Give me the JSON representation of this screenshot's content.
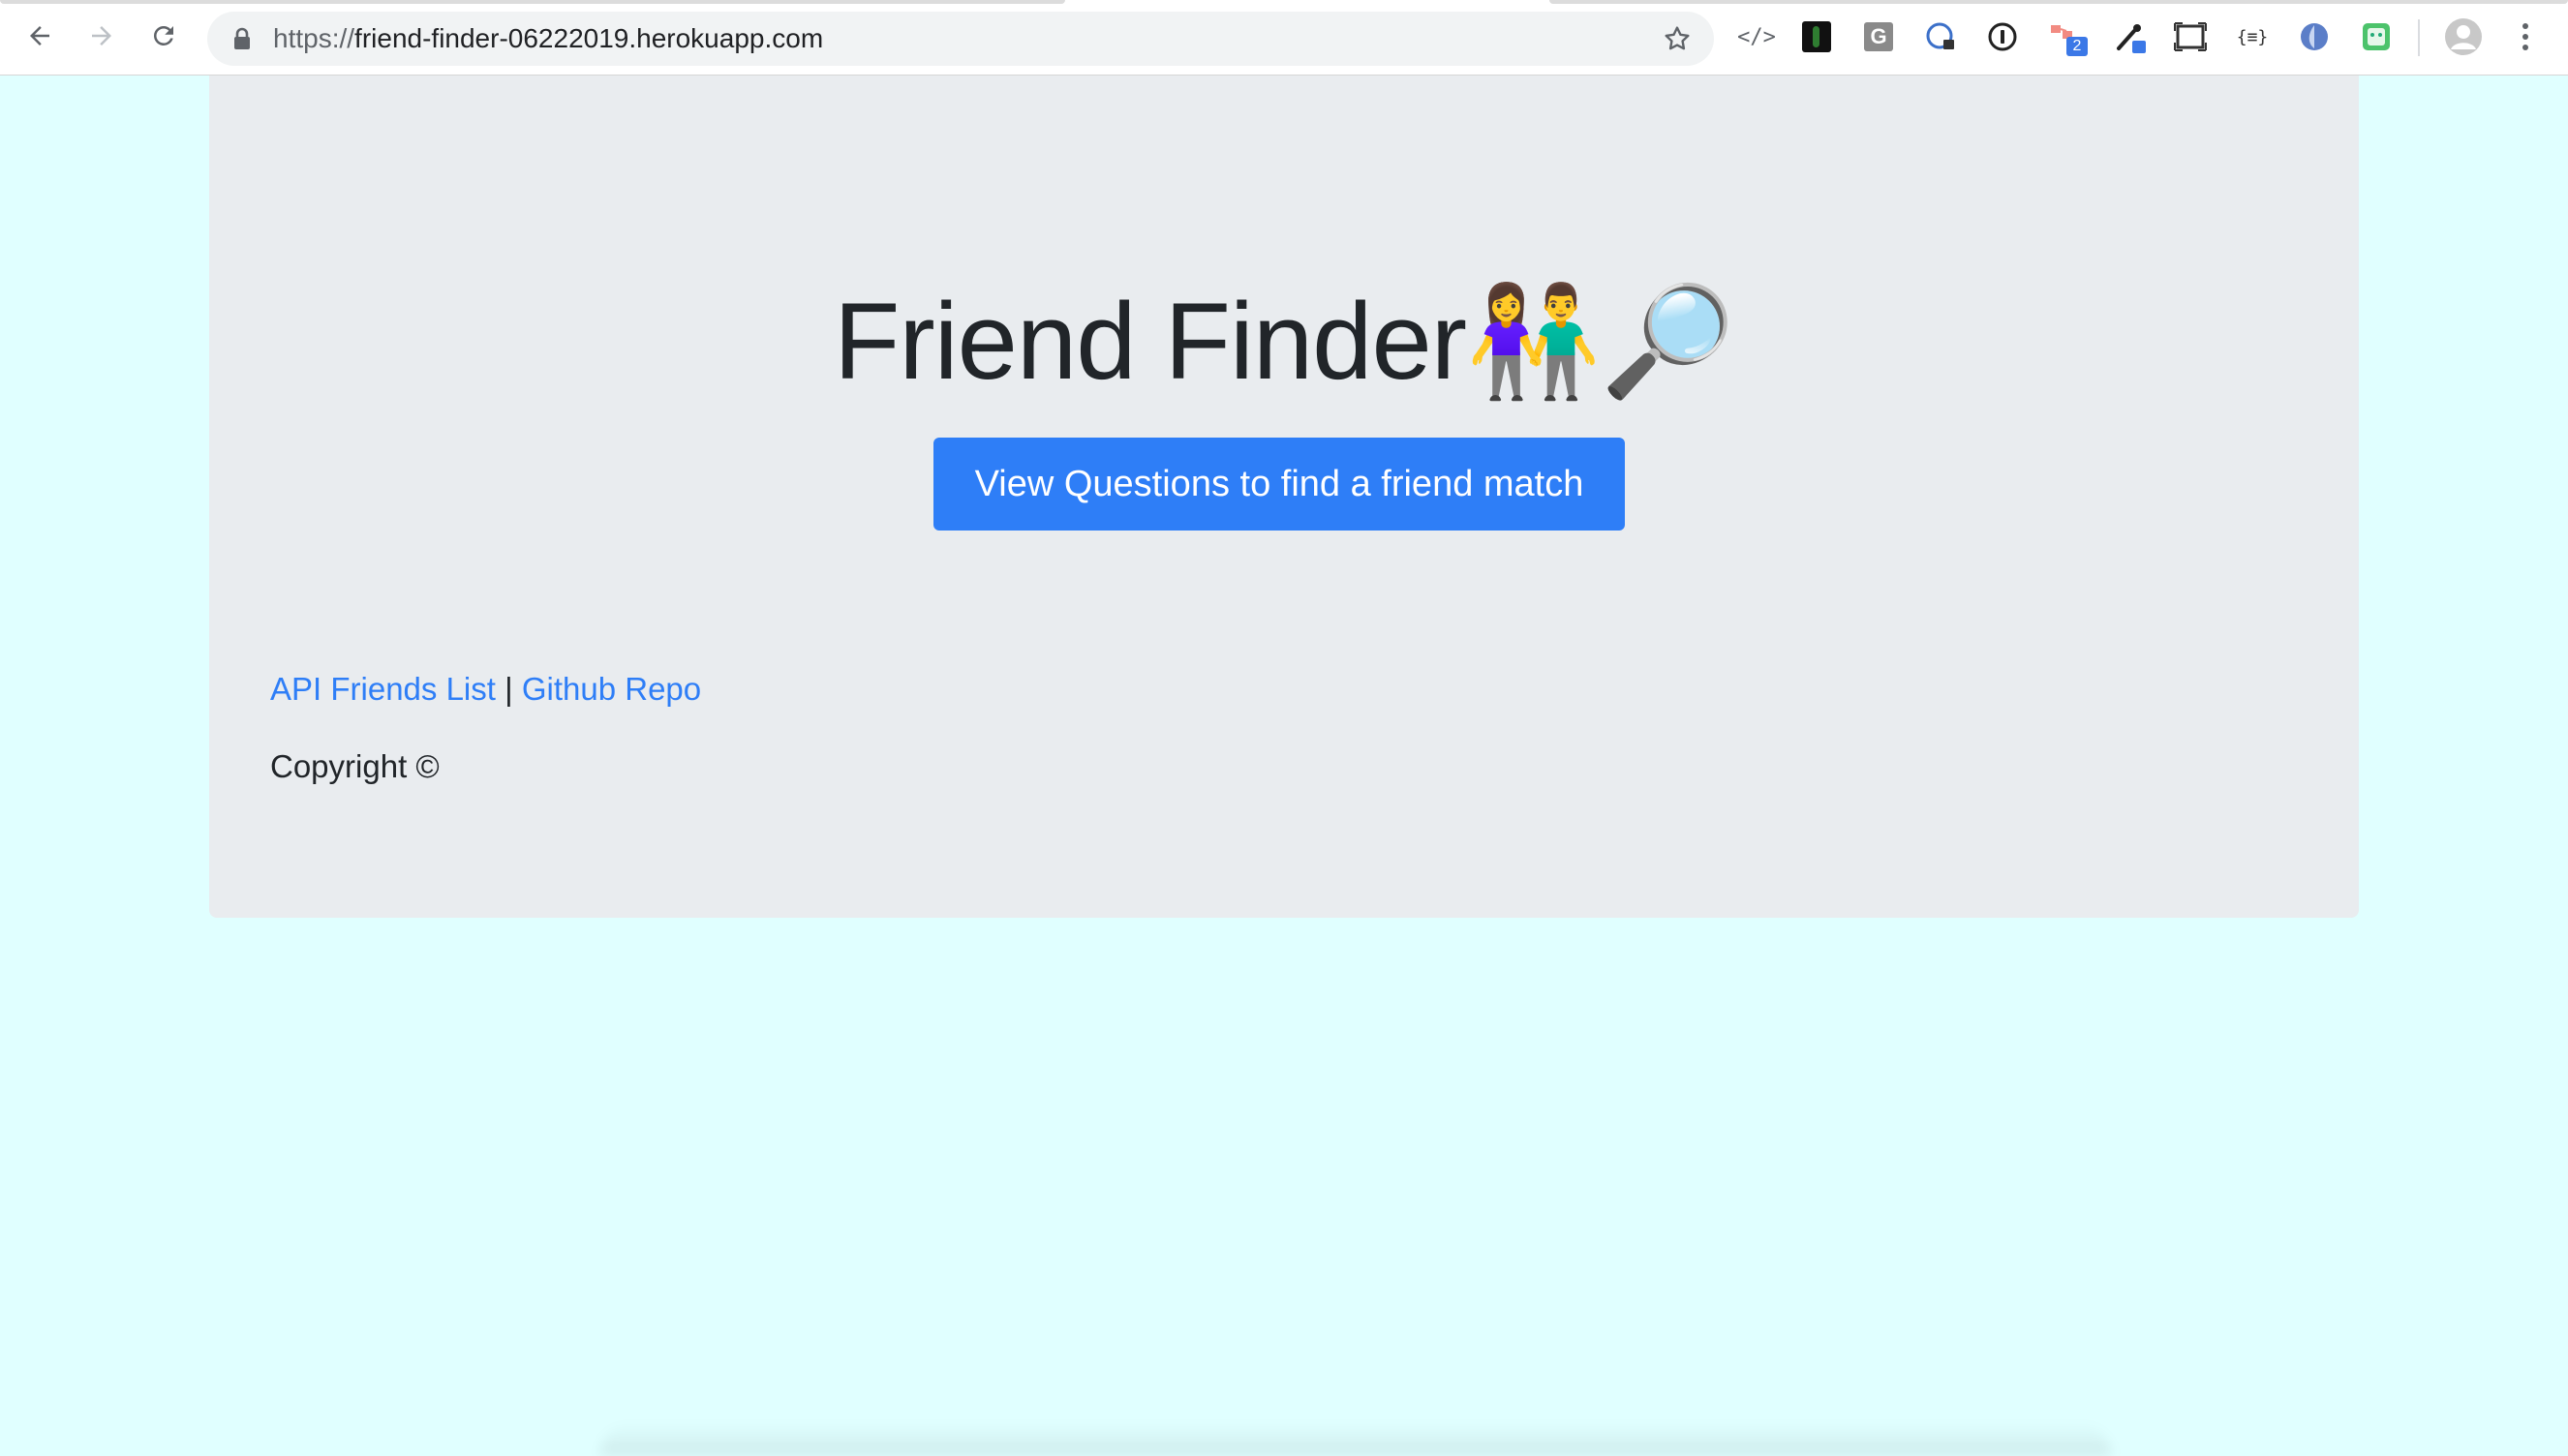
{
  "browser": {
    "url_scheme": "https://",
    "url_host": "friend-finder-06222019.herokuapp.com",
    "ext_badge_count": "2"
  },
  "page": {
    "title": "Friend Finder",
    "title_emoji": "👫🔎",
    "cta_label": "View Questions to find a friend match",
    "footer": {
      "link_api": "API Friends List",
      "separator": "|",
      "link_repo": "Github Repo",
      "copyright": "Copyright ©"
    }
  },
  "colors": {
    "page_background": "#e0ffff",
    "jumbotron": "#e9ecef",
    "primary": "#2e7ef7",
    "text": "#212529"
  },
  "icons": [
    "back-arrow-icon",
    "forward-arrow-icon",
    "reload-icon",
    "lock-icon",
    "bookmark-star-icon",
    "code-icon",
    "profile-avatar-icon",
    "menu-kebab-icon"
  ]
}
